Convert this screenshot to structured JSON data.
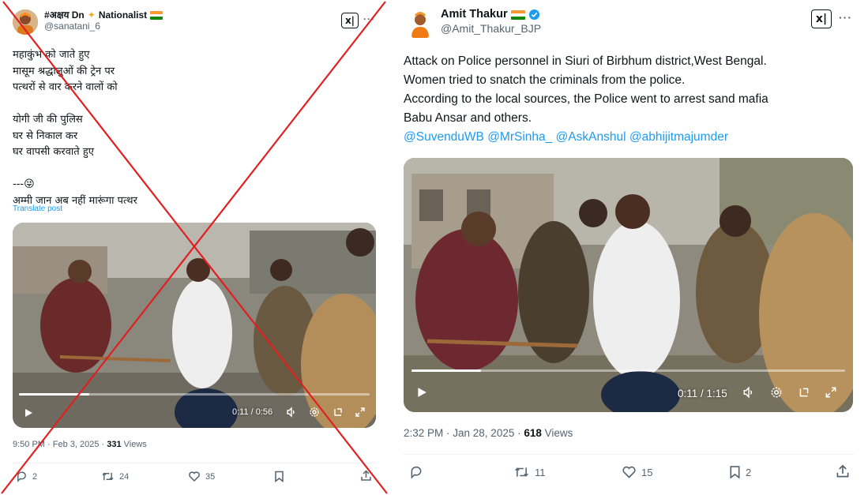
{
  "left_post": {
    "display_name": "#अक्षय Dn",
    "name_suffix": "Nationalist",
    "handle": "@sanatani_6",
    "body": "महाकुंभ को जाते हुए\nमासूम श्रद्धालुओं की ट्रेन पर\nपत्थरों से वार करने वालों को\n\nयोगी जी की पुलिस\nघर से निकाल कर\nघर वापसी करवाते हुए\n\n---😜\nअम्मी जान अब नहीं मारूंगा पत्थर",
    "translate_label": "Translate post",
    "video_time": "0:11 / 0:56",
    "video_progress": 0.2,
    "meta_time": "9:50 PM · Feb 3, 2025 · ",
    "meta_views_count": "331",
    "meta_views_label": " Views",
    "actions": {
      "reply": "2",
      "retweet": "24",
      "like": "35"
    },
    "crossed_out": true
  },
  "right_post": {
    "display_name": "Amit Thakur",
    "handle": "@Amit_Thakur_BJP",
    "body": "Attack on Police personnel in Siuri of Birbhum district,West Bengal.\nWomen tried to snatch the criminals from the police.\nAccording to the local sources, the Police went to arrest sand mafia\nBabu Ansar and others.",
    "mentions": "@SuvenduWB @MrSinha_ @AskAnshul @abhijitmajumder",
    "video_time": "0:11 / 1:15",
    "video_progress": 0.16,
    "meta_time": "2:32 PM · Jan 28, 2025 · ",
    "meta_views_count": "618",
    "meta_views_label": " Views",
    "actions": {
      "reply": "",
      "retweet": "11",
      "like": "15",
      "bookmark": "2"
    }
  },
  "grok_label": "x|",
  "more_label": "···",
  "colors": {
    "accent": "#1d9bf0",
    "cross": "#e02020",
    "muted": "#536471"
  }
}
